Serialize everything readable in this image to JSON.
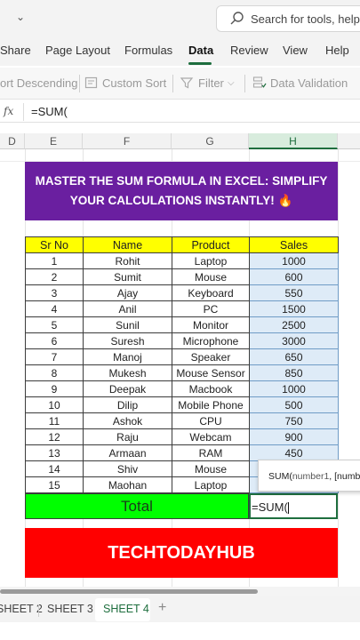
{
  "search": {
    "placeholder": "Search for tools, help,"
  },
  "tabs": [
    "Share",
    "Page Layout",
    "Formulas",
    "Data",
    "Review",
    "View",
    "Help"
  ],
  "active_tab": "Data",
  "commands": {
    "sort_descending": "ort Descending",
    "custom_sort": "Custom Sort",
    "filter": "Filter",
    "data_validation": "Data Validation"
  },
  "formula_bar": {
    "fx": "fx",
    "formula": "=SUM("
  },
  "columns": [
    "D",
    "E",
    "F",
    "G",
    "H"
  ],
  "selected_column": "H",
  "banner": {
    "line1": "MASTER THE SUM FORMULA IN EXCEL: SIMPLIFY",
    "line2": "YOUR CALCULATIONS INSTANTLY! 🔥"
  },
  "table": {
    "headers": [
      "Sr No",
      "Name",
      "Product",
      "Sales"
    ],
    "rows": [
      [
        "1",
        "Rohit",
        "Laptop",
        "1000"
      ],
      [
        "2",
        "Sumit",
        "Mouse",
        "600"
      ],
      [
        "3",
        "Ajay",
        "Keyboard",
        "550"
      ],
      [
        "4",
        "Anil",
        "PC",
        "1500"
      ],
      [
        "5",
        "Sunil",
        "Monitor",
        "2500"
      ],
      [
        "6",
        "Suresh",
        "Microphone",
        "3000"
      ],
      [
        "7",
        "Manoj",
        "Speaker",
        "650"
      ],
      [
        "8",
        "Mukesh",
        "Mouse Sensor",
        "850"
      ],
      [
        "9",
        "Deepak",
        "Macbook",
        "1000"
      ],
      [
        "10",
        "Dilip",
        "Mobile Phone",
        "500"
      ],
      [
        "11",
        "Ashok",
        "CPU",
        "750"
      ],
      [
        "12",
        "Raju",
        "Webcam",
        "900"
      ],
      [
        "13",
        "Armaan",
        "RAM",
        "450"
      ],
      [
        "14",
        "Shiv",
        "Mouse",
        ""
      ],
      [
        "15",
        "Maohan",
        "Laptop",
        ""
      ]
    ]
  },
  "total": {
    "label": "Total",
    "edit_text": "=SUM("
  },
  "tooltip": {
    "func": "SUM(",
    "arg1": "number1",
    "rest": ", [numb"
  },
  "footer_banner": "TECHTODAYHUB",
  "sheets": [
    "SHEET 2",
    "SHEET 3",
    "SHEET 4"
  ],
  "active_sheet": "SHEET 4",
  "colors": {
    "banner_purple": "#6a1fa0",
    "header_yellow": "#ffff00",
    "total_green": "#00ff00",
    "footer_red": "#ff0000",
    "excel_green": "#1e6e3e",
    "sales_blue": "#deebf7"
  }
}
